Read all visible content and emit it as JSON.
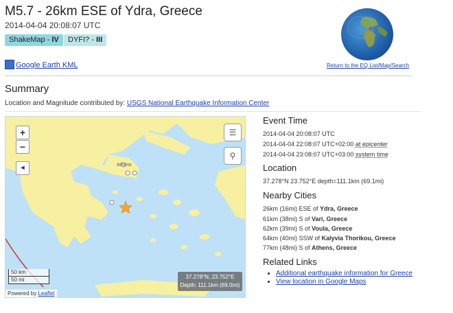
{
  "header": {
    "title": "M5.7 - 26km ESE of Ydra, Greece",
    "datetime": "2014-04-04 20:08:07 UTC",
    "badges": [
      {
        "name": "ShakeMap - ",
        "value": "IV"
      },
      {
        "name": "DYFI? - ",
        "value": "III"
      }
    ],
    "kml_link": "Google Earth KML",
    "return_link": "Return to the EQ List/Map/Search"
  },
  "summary": {
    "heading": "Summary",
    "contributed_by_label": "Location and Magnitude contributed by: ",
    "contributor_link": "USGS National Earthquake Information Center"
  },
  "map": {
    "zoom_in": "+",
    "zoom_out": "−",
    "scale_km": "50 km",
    "scale_mi": "50 mi",
    "attribution_prefix": "Powered by ",
    "attribution_link": "Leaflet",
    "city_label": "Athens",
    "coords": "37.278°N, 23.752°E",
    "depth": "Depth: 111.1km (69.0mi)"
  },
  "event_time": {
    "heading": "Event Time",
    "utc": "2014-04-04 20:08:07 UTC",
    "epicenter_time": "2014-04-04 22:08:07 UTC+02:00",
    "epicenter_label": "at epicenter",
    "system_time": "2014-04-04 23:08:07 UTC+03:00",
    "system_label": "system time"
  },
  "location": {
    "heading": "Location",
    "value": "37.278°N 23.752°E depth=111.1km (69.1mi)"
  },
  "nearby_cities": {
    "heading": "Nearby Cities",
    "items": [
      {
        "prefix": "26km (16mi) ESE of ",
        "city": "Ydra, Greece"
      },
      {
        "prefix": "61km (38mi) S of ",
        "city": "Vari, Greece"
      },
      {
        "prefix": "62km (39mi) S of ",
        "city": "Voula, Greece"
      },
      {
        "prefix": "64km (40mi) SSW of ",
        "city": "Kalyvia Thorikou, Greece"
      },
      {
        "prefix": "77km (48mi) S of ",
        "city": "Athens, Greece"
      }
    ]
  },
  "related_links": {
    "heading": "Related Links",
    "items": [
      "Additional earthquake information for Greece",
      "View location in Google Maps"
    ]
  },
  "colors": {
    "link": "#1a3fa6",
    "badge_shakemap": "#8fd6e0",
    "badge_dyfi": "#bfe6ea",
    "sea": "#bfe1f7",
    "land": "#f6f0a0",
    "epicenter_star": "#f2a531"
  }
}
